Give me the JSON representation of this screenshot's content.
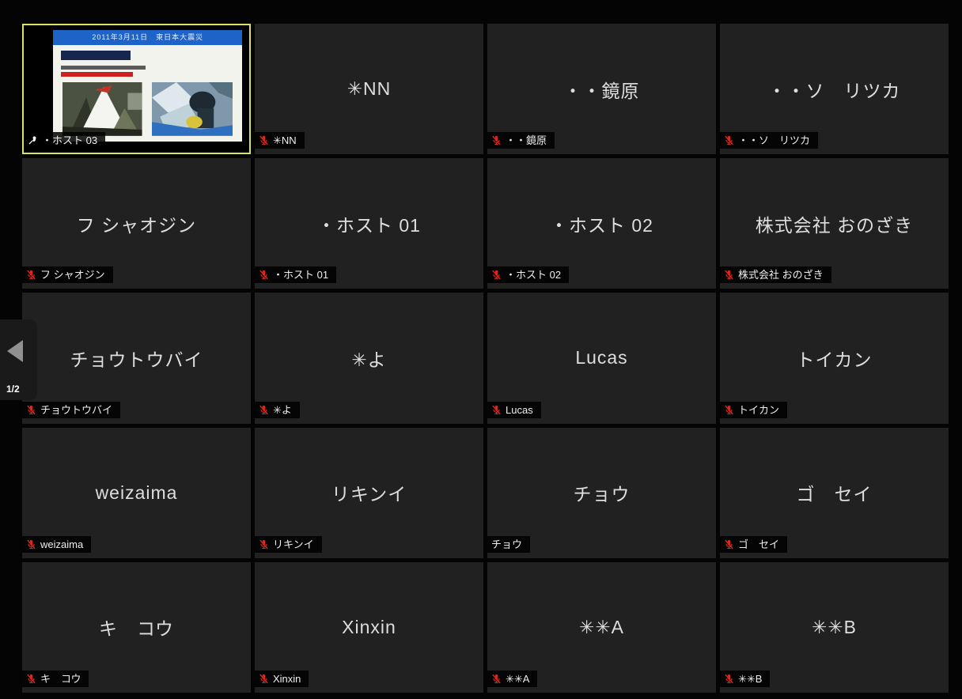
{
  "pagination": {
    "label": "1/2",
    "prev_icon": "left-arrow"
  },
  "colors": {
    "active_border": "#d9e35f",
    "tile_background": "#212121",
    "muted_mic_red": "#d5281f",
    "label_bar": "rgba(0,0,0,0.85)",
    "slide_header_blue": "#1e63c8"
  },
  "share_tile": {
    "slide_title": "2011年3月11日　東日本大震災"
  },
  "icons": {
    "muted": "mic-off-icon",
    "host_pin": "pin-icon",
    "page_prev": "left-arrow-icon"
  },
  "participants": [
    {
      "name": "・ホスト 03",
      "muted": false,
      "pinned": true,
      "video": true,
      "active": true
    },
    {
      "name": "✳NN",
      "muted": true,
      "pinned": false,
      "video": false,
      "active": false
    },
    {
      "name": "・・鏡原",
      "muted": true,
      "pinned": false,
      "video": false,
      "active": false
    },
    {
      "name": "・・ソ　リツカ",
      "muted": true,
      "pinned": false,
      "video": false,
      "active": false
    },
    {
      "name": "フ シャオジン",
      "muted": true,
      "pinned": false,
      "video": false,
      "active": false
    },
    {
      "name": "・ホスト 01",
      "muted": true,
      "pinned": false,
      "video": false,
      "active": false
    },
    {
      "name": "・ホスト 02",
      "muted": true,
      "pinned": false,
      "video": false,
      "active": false
    },
    {
      "name": "株式会社 おのざき",
      "muted": true,
      "pinned": false,
      "video": false,
      "active": false
    },
    {
      "name": "チョウトウバイ",
      "muted": true,
      "pinned": false,
      "video": false,
      "active": false
    },
    {
      "name": "✳よ",
      "muted": true,
      "pinned": false,
      "video": false,
      "active": false
    },
    {
      "name": "Lucas",
      "muted": true,
      "pinned": false,
      "video": false,
      "active": false
    },
    {
      "name": "トイカン",
      "muted": true,
      "pinned": false,
      "video": false,
      "active": false
    },
    {
      "name": "weizaima",
      "muted": true,
      "pinned": false,
      "video": false,
      "active": false
    },
    {
      "name": "リキンイ",
      "muted": true,
      "pinned": false,
      "video": false,
      "active": false
    },
    {
      "name": "チョウ",
      "muted": false,
      "pinned": false,
      "video": false,
      "active": false
    },
    {
      "name": "ゴ　セイ",
      "muted": true,
      "pinned": false,
      "video": false,
      "active": false
    },
    {
      "name": "キ　コウ",
      "muted": true,
      "pinned": false,
      "video": false,
      "active": false
    },
    {
      "name": "Xinxin",
      "muted": true,
      "pinned": false,
      "video": false,
      "active": false
    },
    {
      "name": "✳✳A",
      "muted": true,
      "pinned": false,
      "video": false,
      "active": false
    },
    {
      "name": "✳✳B",
      "muted": true,
      "pinned": false,
      "video": false,
      "active": false
    }
  ]
}
